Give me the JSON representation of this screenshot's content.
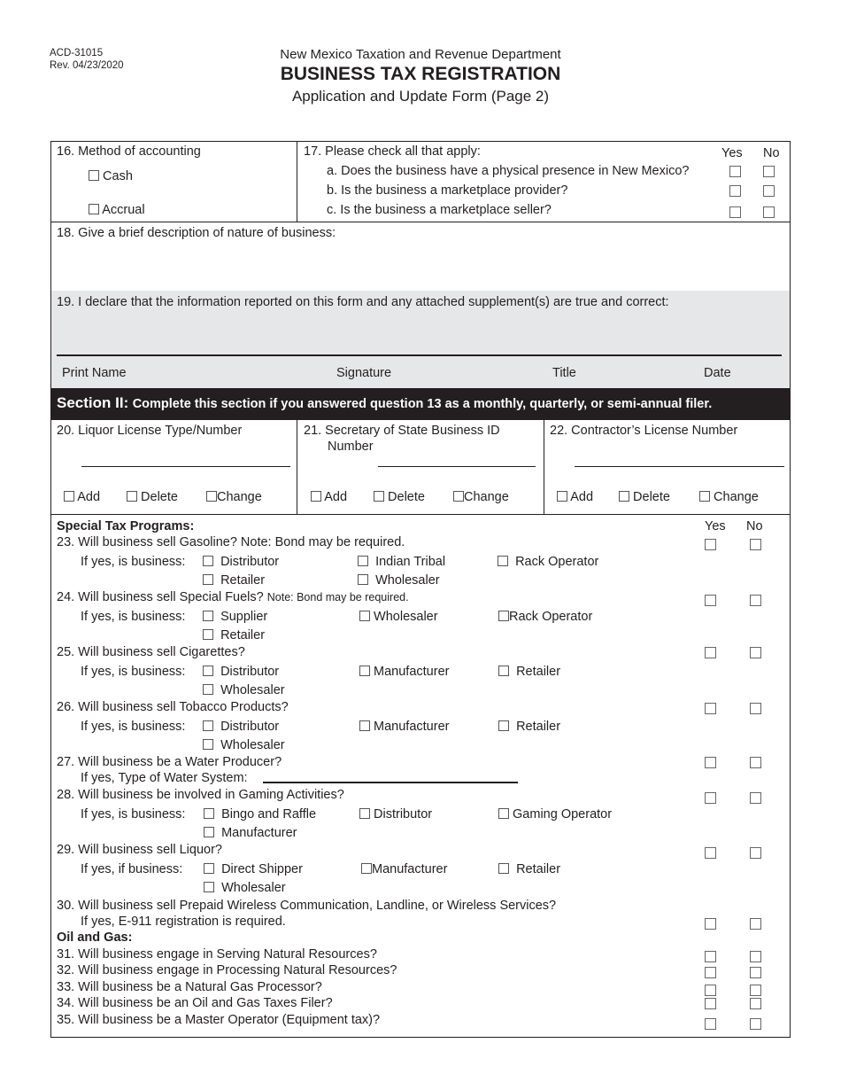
{
  "header": {
    "form_number": "ACD-31015",
    "revision": "Rev. 04/23/2020",
    "department": "New Mexico Taxation and Revenue Department",
    "title": "BUSINESS TAX REGISTRATION",
    "subtitle": "Application and Update Form (Page 2)"
  },
  "q16": {
    "label": "16. Method of accounting",
    "options": [
      "Cash",
      "Accrual"
    ]
  },
  "q17": {
    "label": "17. Please check all that apply:",
    "yes": "Yes",
    "no": "No",
    "items": [
      "a. Does the business have a physical presence in New Mexico?",
      "b. Is the business a marketplace provider?",
      "c. Is the business a marketplace seller?"
    ]
  },
  "q18": {
    "label": "18. Give a brief description of nature of business:"
  },
  "q19": {
    "label": "19. I declare that the information reported on this form and any attached supplement(s) are true and correct:",
    "fields": [
      "Print Name",
      "Signature",
      "Title",
      "Date"
    ]
  },
  "section2": {
    "title": "Section II:",
    "instruction": "Complete this section if you answered question 13 as a monthly, quarterly, or semi-annual filer."
  },
  "licenses": [
    {
      "label": "20. Liquor License Type/Number",
      "label2": ""
    },
    {
      "label": "21. Secretary of State Business ID",
      "label2": "Number"
    },
    {
      "label": "22. Contractor’s License Number",
      "label2": ""
    }
  ],
  "license_actions": [
    "Add",
    "Delete",
    "Change"
  ],
  "special": {
    "heading": "Special Tax Programs:",
    "yes": "Yes",
    "no": "No",
    "if_yes_is": "If yes, is business:",
    "if_yes_if": "If yes, if business:",
    "q23": {
      "text": "23. Will business sell Gasoline? Note: Bond may be required.",
      "options": [
        "Distributor",
        "Indian Tribal",
        "Rack Operator",
        "Retailer",
        "Wholesaler"
      ]
    },
    "q24": {
      "text": "24. Will business sell Special Fuels?",
      "note": "Note: Bond may be required.",
      "options": [
        "Supplier",
        "Wholesaler",
        "Rack Operator",
        "Retailer"
      ]
    },
    "q25": {
      "text": "25. Will business sell Cigarettes?",
      "options": [
        "Distributor",
        "Manufacturer",
        "Retailer",
        "Wholesaler"
      ]
    },
    "q26": {
      "text": "26. Will business sell Tobacco Products?",
      "options": [
        "Distributor",
        "Manufacturer",
        "Retailer",
        "Wholesaler"
      ]
    },
    "q27": {
      "text": "27. Will business be a Water Producer?",
      "sub": "If yes, Type of Water System:"
    },
    "q28": {
      "text": "28. Will business be involved in Gaming Activities?",
      "options": [
        "Bingo and Raffle",
        "Distributor",
        "Gaming Operator",
        "Manufacturer"
      ]
    },
    "q29": {
      "text": "29. Will business sell Liquor?",
      "options": [
        "Direct Shipper",
        "Manufacturer",
        "Retailer",
        "Wholesaler"
      ]
    },
    "q30": {
      "text": "30. Will business sell Prepaid Wireless Communication, Landline, or Wireless Services?",
      "sub": "If yes, E-911 registration is required."
    }
  },
  "oil_gas": {
    "heading": "Oil and Gas:",
    "items": [
      "31. Will business engage in Serving Natural Resources?",
      "32. Will business engage in Processing Natural Resources?",
      "33. Will business be a Natural Gas Processor?",
      "34. Will business be an Oil and Gas Taxes Filer?",
      "35. Will business be a Master Operator (Equipment tax)?"
    ]
  }
}
